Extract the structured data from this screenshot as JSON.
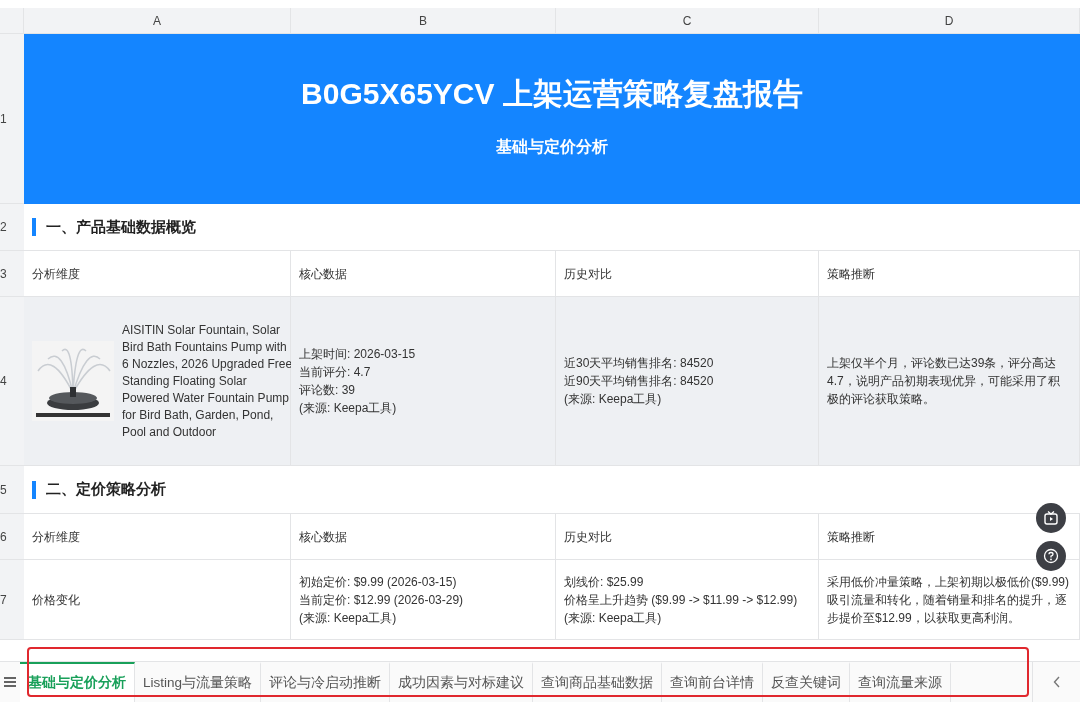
{
  "columns": [
    "A",
    "B",
    "C",
    "D"
  ],
  "title_row": {
    "row": "1",
    "title": "B0G5X65YCV 上架运营策略复盘报告",
    "subtitle": "基础与定价分析"
  },
  "sections": [
    {
      "row": "2",
      "heading": "一、产品基础数据概览",
      "header_row": "3",
      "headers": [
        "分析维度",
        "核心数据",
        "历史对比",
        "策略推断"
      ],
      "data_row": "4",
      "shaded": true,
      "cells": [
        {
          "kind": "product",
          "lines": [
            "AISITIN Solar Fountain, Solar Bird Bath Fountains Pump with 6 Nozzles, 2026 Upgraded Free Standing Floating Solar Powered Water Fountain Pump for Bird Bath, Garden, Pond, Pool and Outdoor"
          ]
        },
        {
          "kind": "text",
          "lines": [
            "上架时间: 2026-03-15",
            "当前评分: 4.7",
            "评论数: 39",
            "(来源: Keepa工具)"
          ]
        },
        {
          "kind": "text",
          "lines": [
            "近30天平均销售排名: 84520",
            "近90天平均销售排名: 84520",
            "(来源: Keepa工具)"
          ]
        },
        {
          "kind": "text",
          "lines": [
            "上架仅半个月，评论数已达39条，评分高达4.7，说明产品初期表现优异，可能采用了积极的评论获取策略。"
          ]
        }
      ]
    },
    {
      "row": "5",
      "heading": "二、定价策略分析",
      "header_row": "6",
      "headers": [
        "分析维度",
        "核心数据",
        "历史对比",
        "策略推断"
      ],
      "data_row": "7",
      "shaded": false,
      "cells": [
        {
          "kind": "text",
          "lines": [
            "价格变化"
          ]
        },
        {
          "kind": "text",
          "lines": [
            "初始定价: $9.99 (2026-03-15)",
            "当前定价: $12.99 (2026-03-29)",
            "(来源: Keepa工具)"
          ]
        },
        {
          "kind": "text",
          "lines": [
            "划线价: $25.99",
            "价格呈上升趋势 ($9.99 -> $11.99 -> $12.99)",
            "(来源: Keepa工具)"
          ]
        },
        {
          "kind": "text",
          "lines": [
            "采用低价冲量策略，上架初期以极低价($9.99)吸引流量和转化，随着销量和排名的提升，逐步提价至$12.99，以获取更高利润。"
          ]
        }
      ]
    }
  ],
  "sheet_tabs": [
    {
      "label": "基础与定价分析",
      "selected": true
    },
    {
      "label": "Listing与流量策略",
      "selected": false
    },
    {
      "label": "评论与冷启动推断",
      "selected": false
    },
    {
      "label": "成功因素与对标建议",
      "selected": false
    },
    {
      "label": "查询商品基础数据",
      "selected": false
    },
    {
      "label": "查询前台详情",
      "selected": false
    },
    {
      "label": "反查关键词",
      "selected": false
    },
    {
      "label": "查询流量来源",
      "selected": false
    }
  ]
}
